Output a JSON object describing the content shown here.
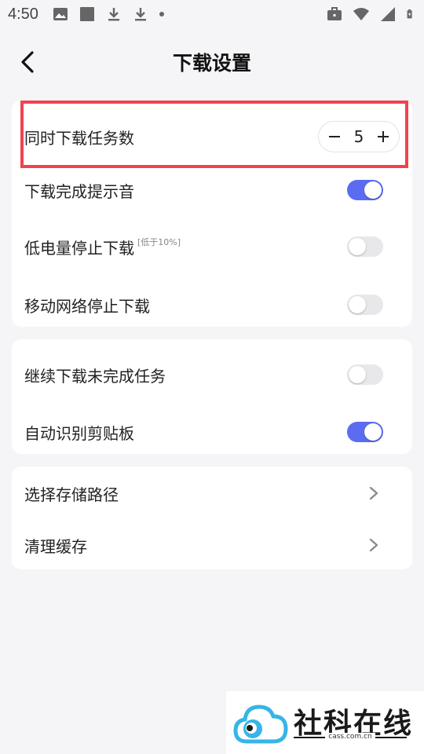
{
  "status_bar": {
    "time": "4:50",
    "left_icons": [
      "image-icon",
      "square-icon",
      "download-icon",
      "download-icon",
      "dot-icon"
    ],
    "right_icons": [
      "briefcase-icon",
      "wifi-icon",
      "signal-icon",
      "battery-charging-icon"
    ]
  },
  "header": {
    "title": "下载设置",
    "back_icon": "chevron-left-icon"
  },
  "group1": {
    "concurrent": {
      "label": "同时下载任务数",
      "value": "5",
      "minus": "−",
      "plus": "+"
    },
    "complete_sound": {
      "label": "下载完成提示音",
      "enabled": true
    },
    "low_battery": {
      "label": "低电量停止下载",
      "note": "[低于10%]",
      "enabled": false
    },
    "mobile_network": {
      "label": "移动网络停止下载",
      "enabled": false
    }
  },
  "group2": {
    "resume": {
      "label": "继续下载未完成任务",
      "enabled": false
    },
    "clipboard": {
      "label": "自动识别剪贴板",
      "enabled": true
    }
  },
  "group3": {
    "storage_path": {
      "label": "选择存储路径"
    },
    "clear_cache": {
      "label": "清理缓存"
    }
  },
  "watermark": {
    "text": "社科在线",
    "sub": "cass.com.cn"
  },
  "colors": {
    "accent": "#5b6cf0",
    "highlight": "#f2424e",
    "background": "#f5f5f7",
    "card": "#ffffff"
  }
}
